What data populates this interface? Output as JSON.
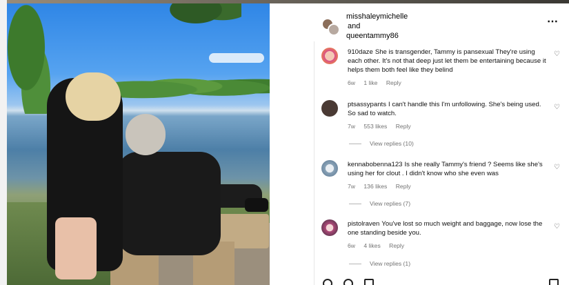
{
  "post": {
    "header": {
      "user1": "misshaleymichelle",
      "conjunction": "and",
      "user2": "queentammy86",
      "more_icon": "more-horizontal-icon"
    }
  },
  "comments": [
    {
      "username": "910daze",
      "text": "She is transgender, Tammy is pansexual  They're using each other. It's not that deep just let them be entertaining because it helps them both feel like they belind",
      "age": "6w",
      "likes": "1 like",
      "reply": "Reply",
      "view_replies": ""
    },
    {
      "username": "ptsassypants",
      "text": "I can't handle this I'm unfollowing. She's being used. So sad to watch.",
      "age": "7w",
      "likes": "553 likes",
      "reply": "Reply",
      "view_replies": "View replies (10)"
    },
    {
      "username": "kennabobenna123",
      "text": "Is she really Tammy's friend ? Seems like she's using her for clout . I didn't know who she even was",
      "age": "7w",
      "likes": "136 likes",
      "reply": "Reply",
      "view_replies": "View replies (7)"
    },
    {
      "username": "pistolraven",
      "text": "You've lost so much weight and baggage, now lose the one standing beside you.",
      "age": "6w",
      "likes": "4 likes",
      "reply": "Reply",
      "view_replies": "View replies (1)"
    }
  ],
  "colors": {
    "meta_text": "#737373",
    "link_text": "#000000"
  }
}
